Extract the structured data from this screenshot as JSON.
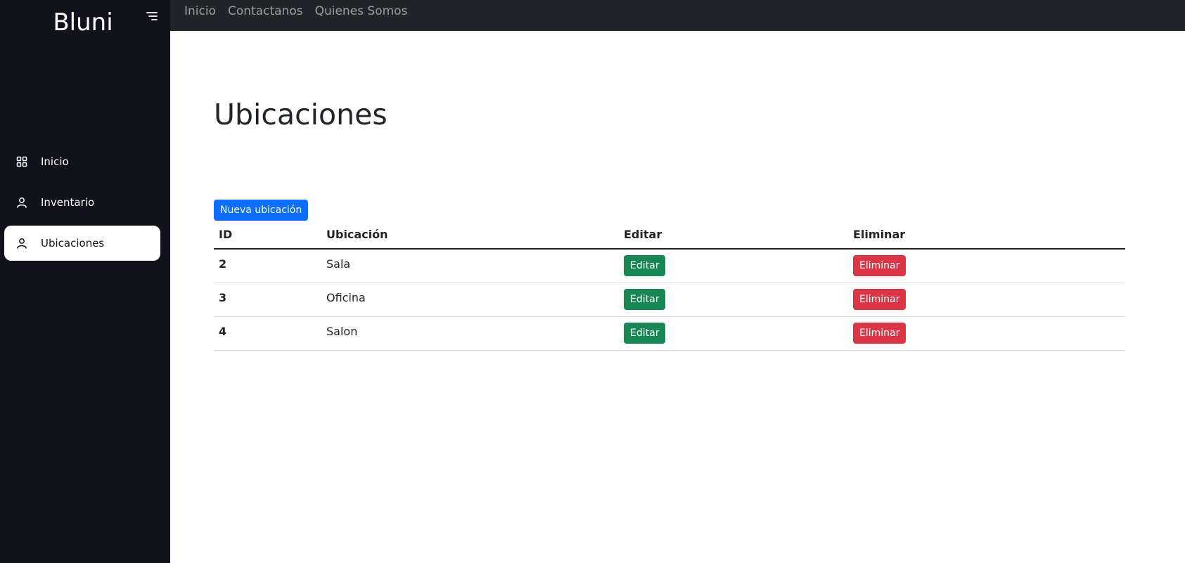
{
  "app": {
    "brand": "Bluni"
  },
  "sidebar": {
    "items": [
      {
        "label": "Inicio",
        "icon": "grid-icon",
        "active": false
      },
      {
        "label": "Inventario",
        "icon": "user-icon",
        "active": false
      },
      {
        "label": "Ubicaciones",
        "icon": "user-icon",
        "active": true
      }
    ]
  },
  "topnav": {
    "links": [
      "Inicio",
      "Contactanos",
      "Quienes Somos"
    ]
  },
  "page": {
    "title": "Ubicaciones",
    "new_button": "Nueva ubicación"
  },
  "table": {
    "headers": [
      "ID",
      "Ubicación",
      "Editar",
      "Eliminar"
    ],
    "rows": [
      {
        "id": "2",
        "ubicacion": "Sala",
        "edit": "Editar",
        "delete": "Eliminar"
      },
      {
        "id": "3",
        "ubicacion": "Oficina",
        "edit": "Editar",
        "delete": "Eliminar"
      },
      {
        "id": "4",
        "ubicacion": "Salon",
        "edit": "Editar",
        "delete": "Eliminar"
      }
    ]
  },
  "colors": {
    "sidebar_bg": "#11121e",
    "topbar_bg": "#212529",
    "primary": "#0d6efd",
    "success": "#198754",
    "danger": "#dc3545"
  }
}
